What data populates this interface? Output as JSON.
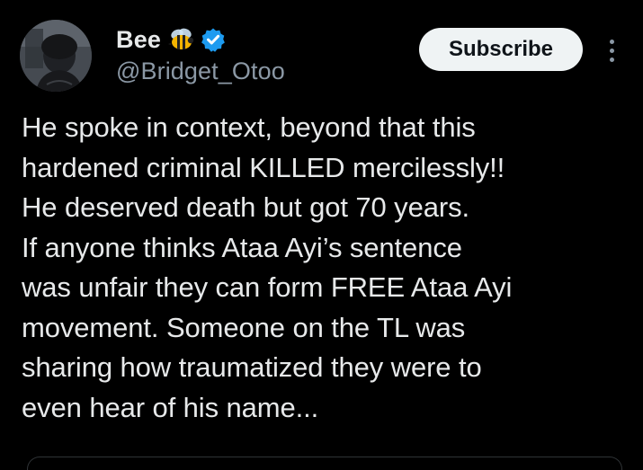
{
  "author": {
    "display_name": "Bee",
    "handle": "@Bridget_Otoo",
    "name_emoji_icon": "bee-icon",
    "verified_icon": "verified-badge-icon",
    "verified_color": "#1d9bf0"
  },
  "actions": {
    "subscribe_label": "Subscribe",
    "more_icon": "more-vertical-icon"
  },
  "tweet": {
    "text": "He spoke in context, beyond that this\nhardened criminal KILLED mercilessly!!\nHe deserved death but got 70 years.\nIf anyone thinks Ataa Ayi’s sentence\nwas unfair they can form FREE Ataa Ayi\nmovement. Someone on the TL was\nsharing how traumatized they were to\neven hear of his name..."
  },
  "colors": {
    "background": "#000000",
    "primary_text": "#e7e9ea",
    "secondary_text": "#8b98a5",
    "subscribe_bg": "#eff3f4"
  }
}
